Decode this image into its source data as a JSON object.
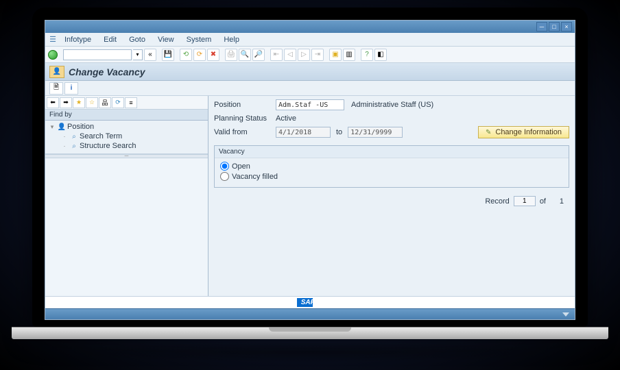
{
  "menu": {
    "items": [
      "Infotype",
      "Edit",
      "Goto",
      "View",
      "System",
      "Help"
    ]
  },
  "section": {
    "title": "Change Vacancy"
  },
  "left": {
    "findby_label": "Find by",
    "tree": {
      "root": "Position",
      "children": [
        "Search Term",
        "Structure Search"
      ]
    }
  },
  "form": {
    "position_label": "Position",
    "position_value": "Adm.Staf -US",
    "position_desc": "Administrative Staff (US)",
    "status_label": "Planning Status",
    "status_value": "Active",
    "valid_label": "Valid from",
    "valid_from": "4/1/2018",
    "to_label": "to",
    "valid_to": "12/31/9999",
    "change_btn": "Change Information"
  },
  "group": {
    "title": "Vacancy",
    "open_label": "Open",
    "filled_label": "Vacancy filled"
  },
  "record": {
    "label": "Record",
    "current": "1",
    "of_label": "of",
    "total": "1"
  },
  "logo": "SAP"
}
